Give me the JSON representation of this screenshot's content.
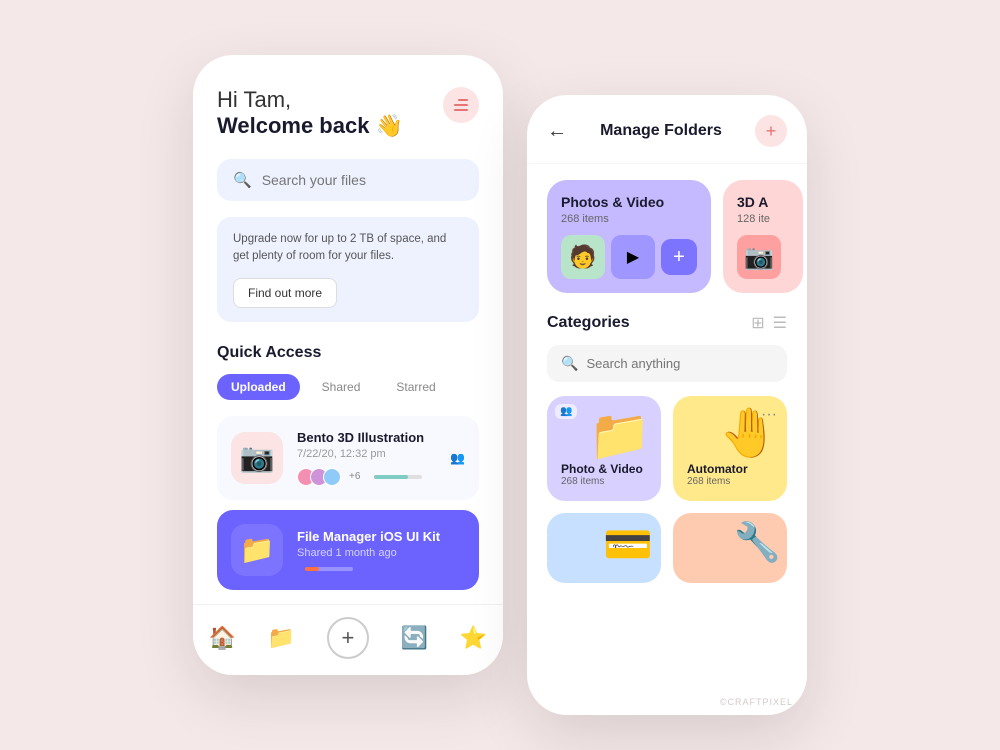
{
  "bg_color": "#f5e8e8",
  "left_phone": {
    "greeting_hi": "Hi Tam,",
    "greeting_welcome": "Welcome back 👋",
    "menu_icon": "≡",
    "search_placeholder": "Search your files",
    "upgrade_text": "Upgrade now for up to 2 TB of space, and get plenty of room for your files.",
    "find_out_label": "Find out more",
    "quick_access_title": "Quick Access",
    "tabs": [
      {
        "label": "Uploaded",
        "active": true
      },
      {
        "label": "Shared",
        "active": false
      },
      {
        "label": "Starred",
        "active": false
      }
    ],
    "files": [
      {
        "name": "Bento 3D Illustration",
        "date": "7/22/20, 12:32 pm",
        "active": false,
        "icon": "📷",
        "progress": 70,
        "avatars": [
          "#f48fb1",
          "#ce93d8",
          "#90caf9"
        ],
        "count": "+6"
      },
      {
        "name": "File Manager iOS UI Kit",
        "date": "Shared 1 month ago",
        "active": true,
        "icon": "📁",
        "progress": 30
      }
    ],
    "nav": [
      "🏠",
      "📁",
      "+",
      "🔄",
      "⭐"
    ]
  },
  "right_phone": {
    "header_title": "Manage Folders",
    "back_icon": "←",
    "add_icon": "+",
    "folders": [
      {
        "name": "Photos & Video",
        "count": "268 items",
        "color": "purple-card"
      },
      {
        "name": "3D A...",
        "count": "128 ite...",
        "color": "pink-card"
      }
    ],
    "categories_title": "Categories",
    "search_placeholder": "Search anything",
    "categories": [
      {
        "name": "Photo & Video",
        "count": "268 items",
        "icon": "📁",
        "color": "lavender",
        "shared": true
      },
      {
        "name": "Automator",
        "count": "268 items",
        "icon": "🤚",
        "color": "yellow",
        "shared": false
      },
      {
        "name": "",
        "count": "",
        "icon": "💳",
        "color": "blue",
        "shared": false
      },
      {
        "name": "",
        "count": "",
        "icon": "🔧",
        "color": "orange",
        "shared": false
      }
    ]
  },
  "watermark": "©CRAFTPIXEL"
}
